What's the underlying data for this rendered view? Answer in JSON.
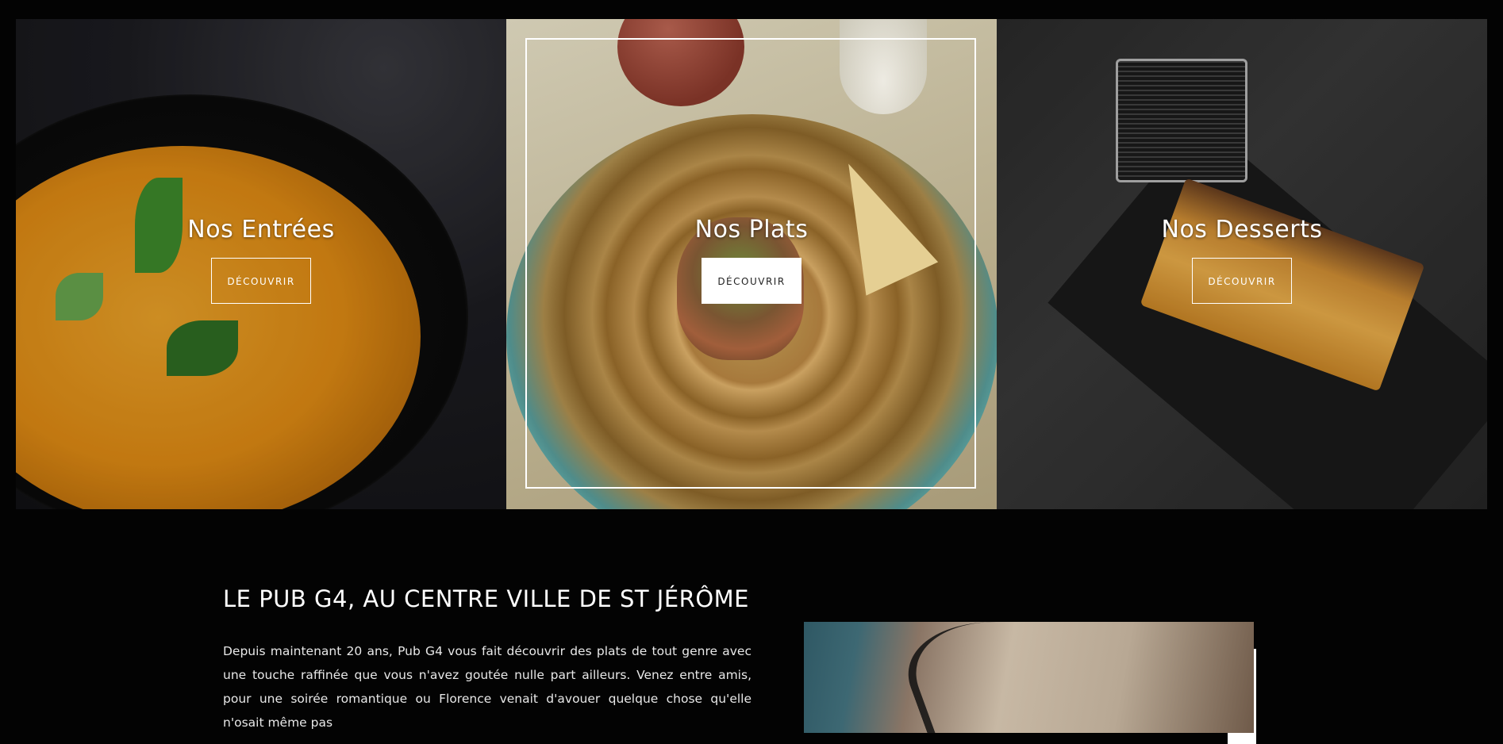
{
  "categories": [
    {
      "title": "Nos Entrées",
      "button": "DÉCOUVRIR"
    },
    {
      "title": "Nos Plats",
      "button": "DÉCOUVRIR"
    },
    {
      "title": "Nos Desserts",
      "button": "DÉCOUVRIR"
    }
  ],
  "intro": {
    "heading": "LE PUB G4, AU CENTRE VILLE DE ST JÉRÔME",
    "paragraph": "Depuis maintenant 20 ans, Pub G4 vous fait découvrir des plats de tout genre avec une touche raffinée que vous n'avez goutée nulle part ailleurs. Venez entre amis, pour une soirée romantique ou Florence venait d'avouer quelque chose qu'elle n'osait même pas"
  },
  "colors": {
    "background": "#030303",
    "text": "#ffffff",
    "button_active_bg": "#ffffff"
  }
}
